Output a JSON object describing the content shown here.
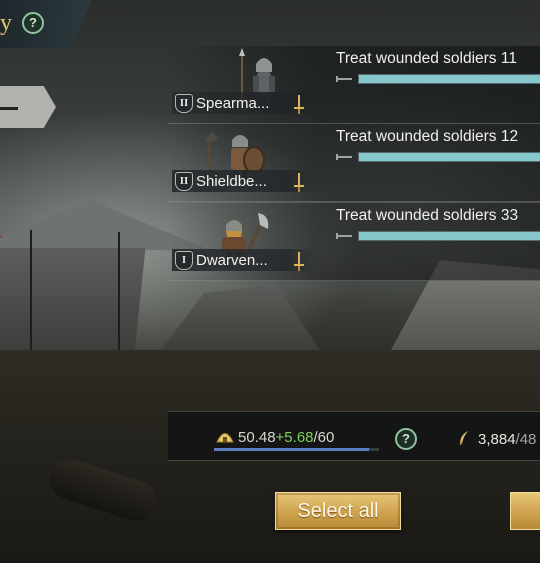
{
  "header": {
    "title_fragment": "y",
    "help_label": "?"
  },
  "troops": [
    {
      "tier": "II",
      "name": "Spearma...",
      "treat_text": "Treat wounded soldiers 11",
      "slider_fraction": 1.0
    },
    {
      "tier": "II",
      "name": "Shieldbe...",
      "treat_text": "Treat wounded soldiers 12",
      "slider_fraction": 1.0
    },
    {
      "tier": "I",
      "name": "Dwarven...",
      "treat_text": "Treat wounded soldiers 33",
      "slider_fraction": 1.0
    }
  ],
  "resources": {
    "capacity_current": "50.48",
    "capacity_added": "+5.68",
    "capacity_max": "/60",
    "capacity_fill_fraction": 0.94,
    "gold_amount": "3,884",
    "gold_max": "/48",
    "help_label": "?"
  },
  "actions": {
    "select_all_label": "Select all"
  },
  "icons": {
    "help": "question-circle-icon",
    "sword": "sword-icon",
    "hut": "hut-icon",
    "feather": "feather-icon",
    "minus": "minus-icon"
  },
  "colors": {
    "title_gold": "#e2c66b",
    "slider_fill": "#86c7cc",
    "capacity_plus": "#7fd35a",
    "button_gold": "#cfa24e"
  }
}
